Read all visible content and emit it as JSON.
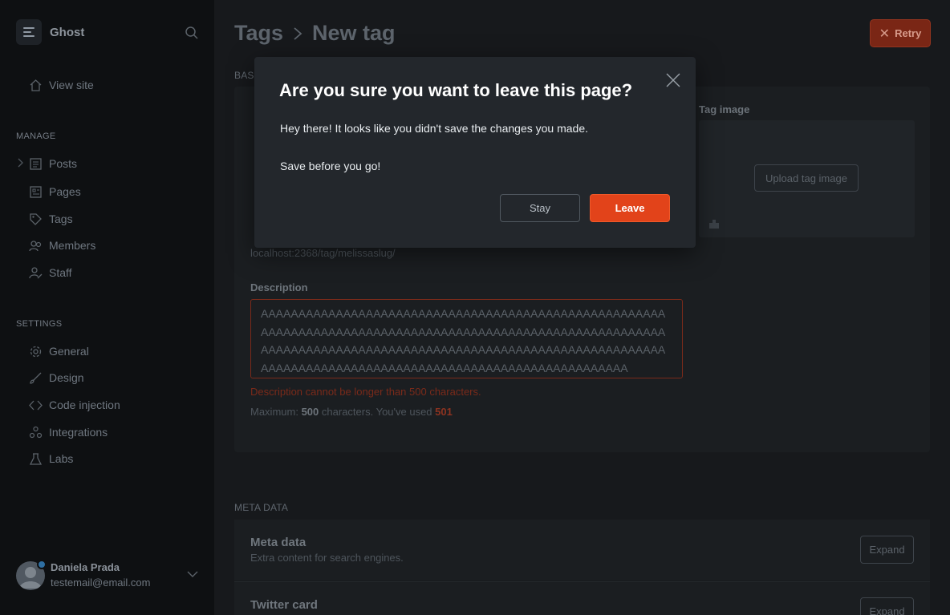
{
  "sidebar": {
    "site_title": "Ghost",
    "view_site": "View site",
    "manage_label": "MANAGE",
    "manage_items": [
      {
        "label": "Posts",
        "icon": "posts-icon"
      },
      {
        "label": "Pages",
        "icon": "pages-icon"
      },
      {
        "label": "Tags",
        "icon": "tag-icon"
      },
      {
        "label": "Members",
        "icon": "members-icon"
      },
      {
        "label": "Staff",
        "icon": "staff-icon"
      }
    ],
    "settings_label": "SETTINGS",
    "settings_items": [
      {
        "label": "General",
        "icon": "gear-icon"
      },
      {
        "label": "Design",
        "icon": "brush-icon"
      },
      {
        "label": "Code injection",
        "icon": "code-icon"
      },
      {
        "label": "Integrations",
        "icon": "integrations-icon"
      },
      {
        "label": "Labs",
        "icon": "flask-icon"
      }
    ],
    "user": {
      "name": "Daniela Prada",
      "email": "testemail@email.com"
    }
  },
  "header": {
    "crumb_parent": "Tags",
    "crumb_current": "New tag",
    "retry_label": "Retry"
  },
  "form": {
    "section_label": "BASI",
    "tag_image_label": "Tag image",
    "upload_label": "Upload tag image",
    "slug_hint": "localhost:2368/tag/melissaslug/",
    "description_label": "Description",
    "description_value": "AAAAAAAAAAAAAAAAAAAAAAAAAAAAAAAAAAAAAAAAAAAAAAAAAAAAAAAAAAAAAAAAAAAAAAAAAAAAAAAAAAAAAAAAAAAAAAAAAAAAAAAAAAAAAAAAAAAAAAAAAAAAAAAAAAAAAAAAAAAAAAAAAAAAAAAAAAAAAAAAAAAAAAAAAAAAAAAAAAAAAAAAAAAAAAAAAAAAAAAAAAAAAAAAAAA",
    "error": "Description cannot be longer than 500 characters.",
    "count_prefix": "Maximum:",
    "count_max": "500",
    "count_mid": "characters. You've used",
    "count_used": "501"
  },
  "meta": {
    "section_label": "META DATA",
    "cards": [
      {
        "title": "Meta data",
        "subtitle": "Extra content for search engines.",
        "button": "Expand"
      },
      {
        "title": "Twitter card",
        "subtitle": "",
        "button": "Expand"
      }
    ]
  },
  "modal": {
    "title": "Are you sure you want to leave this page?",
    "message1": "Hey there! It looks like you didn't save the changes you made.",
    "message2": "Save before you go!",
    "stay_label": "Stay",
    "leave_label": "Leave"
  },
  "colors": {
    "accent": "#e2431a",
    "error": "#7a2a1a",
    "background": "#17191c",
    "sidebar": "#0e1012"
  }
}
